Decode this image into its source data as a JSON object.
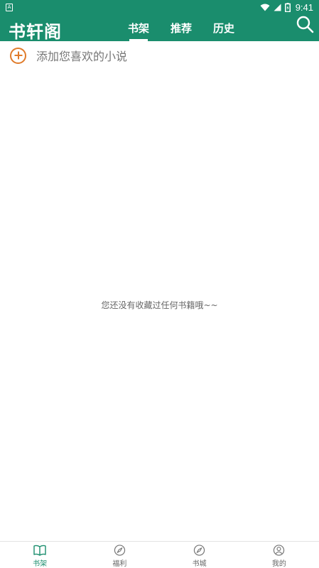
{
  "status_bar": {
    "time": "9:41",
    "left_icon": "notification-a-icon",
    "icons": [
      "wifi-icon",
      "signal-icon",
      "battery-icon"
    ]
  },
  "header": {
    "title": "书轩阁",
    "tabs": [
      {
        "label": "书架",
        "active": true
      },
      {
        "label": "推荐",
        "active": false
      },
      {
        "label": "历史",
        "active": false
      }
    ],
    "search_icon": "search-icon"
  },
  "main": {
    "add_novel_label": "添加您喜欢的小说",
    "empty_message": "您还没有收藏过任何书籍哦~~"
  },
  "bottom_nav": {
    "items": [
      {
        "label": "书架",
        "icon": "book-icon",
        "active": true
      },
      {
        "label": "福利",
        "icon": "compass-icon",
        "active": false
      },
      {
        "label": "书城",
        "icon": "compass-icon",
        "active": false
      },
      {
        "label": "我的",
        "icon": "user-icon",
        "active": false
      }
    ]
  },
  "colors": {
    "primary": "#1a8d6d",
    "accent": "#e07b2a",
    "text_muted": "#777777"
  }
}
